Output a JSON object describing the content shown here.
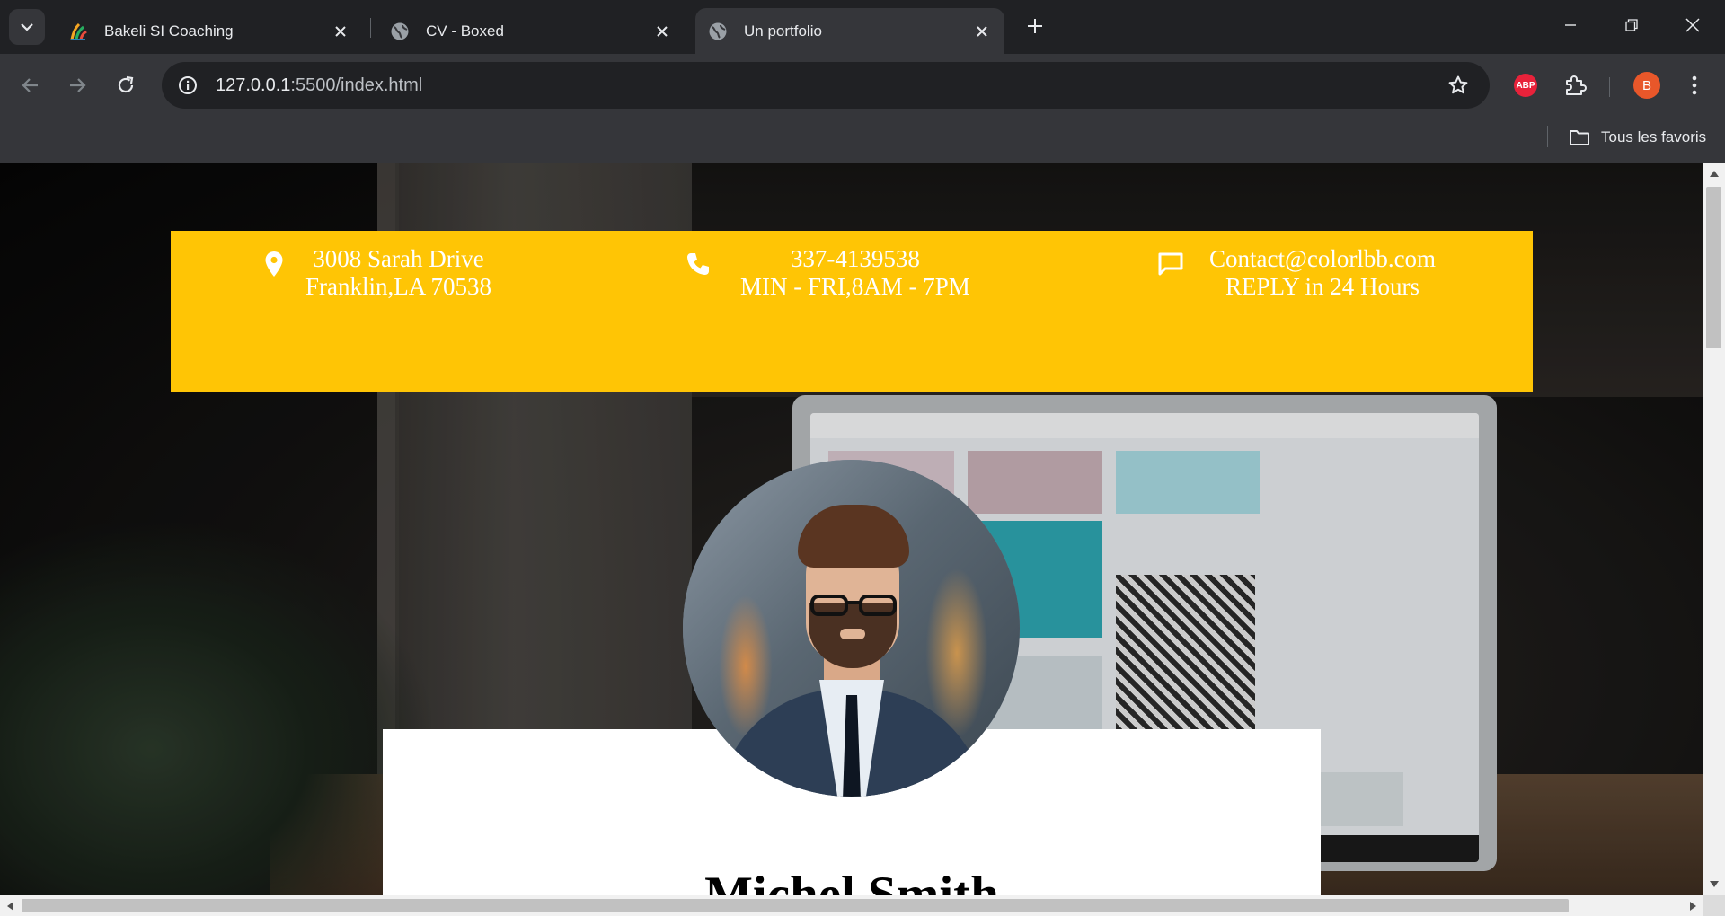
{
  "browser": {
    "tabs": [
      {
        "title": "Bakeli SI Coaching",
        "active": false,
        "favicon": "bakeli-logo-icon"
      },
      {
        "title": "CV - Boxed",
        "active": false,
        "favicon": "globe-icon"
      },
      {
        "title": "Un portfolio",
        "active": true,
        "favicon": "globe-icon"
      }
    ],
    "url_host": "127.0.0.1",
    "url_path": ":5500/index.html",
    "profile_initial": "B",
    "abp_label": "ABP",
    "bookmarks_all": "Tous les favoris"
  },
  "contact": {
    "address": {
      "line1": "3008 Sarah Drive",
      "line2": "Franklin,LA 70538",
      "icon": "location-pin-icon"
    },
    "phone": {
      "line1": "337-4139538",
      "line2": "MIN - FRI,8AM - 7PM",
      "icon": "phone-icon"
    },
    "email": {
      "line1": "Contact@colorlbb.com",
      "line2": "REPLY in 24 Hours",
      "icon": "chat-bubble-icon"
    }
  },
  "profile": {
    "name": "Michel Smith"
  },
  "colors": {
    "accent": "#ffc505",
    "chrome_dark": "#202124",
    "chrome_mid": "#35363a",
    "profile_badge": "#e8572a",
    "abp_badge": "#e8223a"
  }
}
